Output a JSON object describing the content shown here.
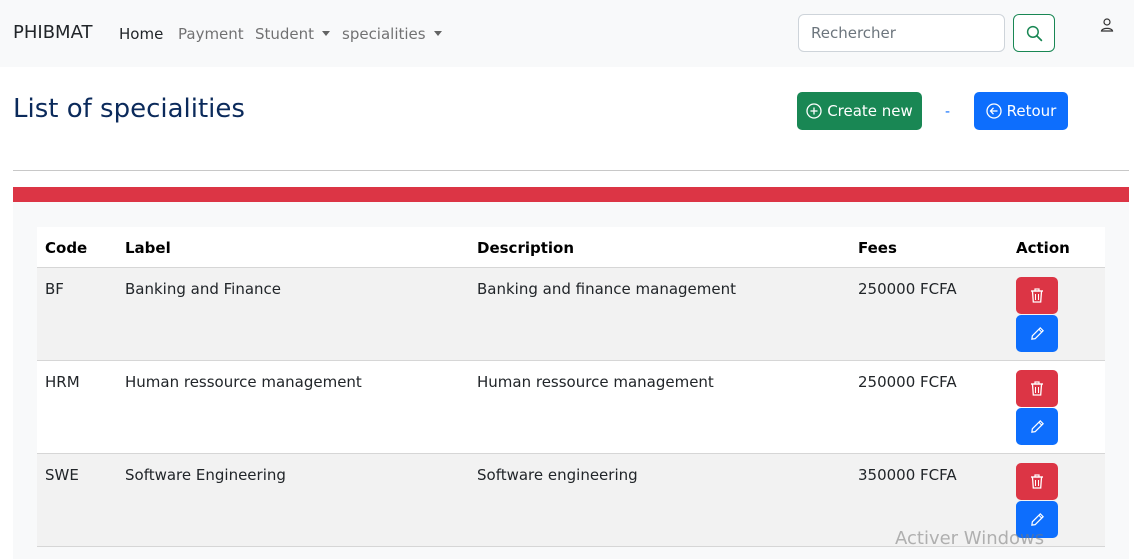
{
  "navbar": {
    "brand": "PHIBMAT",
    "links": [
      {
        "label": "Home",
        "active": true
      },
      {
        "label": "Payment"
      },
      {
        "label": "Student",
        "dropdown": true
      },
      {
        "label": "specialities",
        "dropdown": true
      }
    ],
    "search_placeholder": "Rechercher",
    "search_icon": "search-icon",
    "user_icon": "user-icon"
  },
  "header": {
    "title": "List of specialities",
    "create_label": "Create new",
    "separator": "-",
    "back_label": "Retour"
  },
  "table": {
    "columns": [
      "Code",
      "Label",
      "Description",
      "Fees",
      "Action"
    ],
    "rows": [
      {
        "code": "BF",
        "label": "Banking and Finance",
        "description": "Banking and finance management",
        "fees": "250000 FCFA"
      },
      {
        "code": "HRM",
        "label": "Human ressource management",
        "description": "Human ressource management",
        "fees": "250000 FCFA"
      },
      {
        "code": "SWE",
        "label": "Software Engineering",
        "description": "Software engineering",
        "fees": "350000 FCFA"
      }
    ]
  },
  "watermark": "Activer Windows",
  "colors": {
    "primary": "#0d6efd",
    "success": "#198754",
    "danger": "#dc3545",
    "title": "#0b2a5b"
  }
}
